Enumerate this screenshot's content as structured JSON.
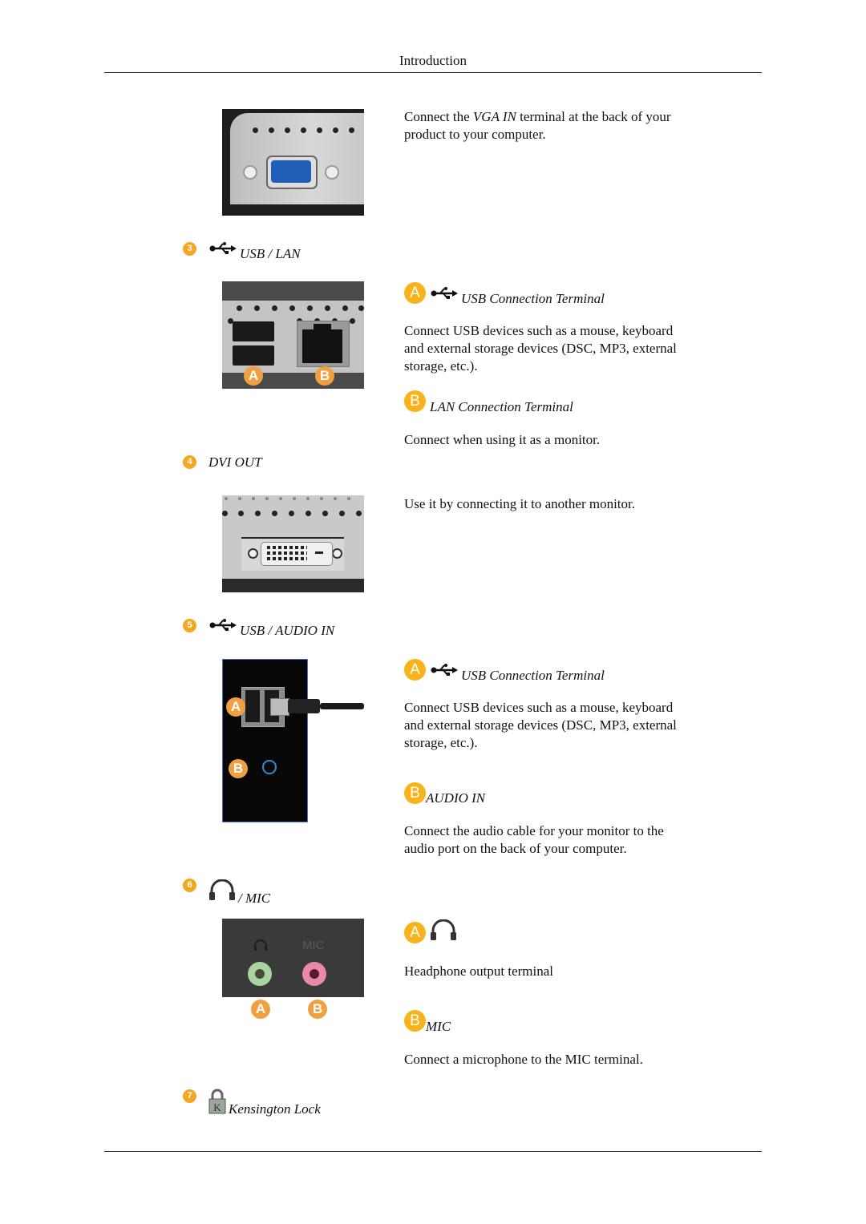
{
  "page": {
    "header": "Introduction"
  },
  "vga": {
    "text_before": "Connect the ",
    "text_emph": "VGA IN",
    "text_after": " terminal at the back of your product to your computer."
  },
  "sections": [
    {
      "number": "3",
      "icon": "usb-icon",
      "title": "USB / LAN",
      "image_labels": [
        "A",
        "B"
      ],
      "items": [
        {
          "badge": "A",
          "icon": "usb-icon",
          "title": "USB Connection Terminal",
          "description": "Connect USB devices such as a mouse, keyboard and external storage devices (DSC, MP3, external storage, etc.)."
        },
        {
          "badge": "B",
          "title": "LAN Connection Terminal",
          "description": "Connect when using it as a monitor."
        }
      ]
    },
    {
      "number": "4",
      "title": "DVI OUT",
      "description": "Use it by connecting it to another monitor."
    },
    {
      "number": "5",
      "icon": "usb-icon",
      "title": "USB / AUDIO IN",
      "image_labels": [
        "A",
        "B"
      ],
      "items": [
        {
          "badge": "A",
          "icon": "usb-icon",
          "title": "USB Connection Terminal",
          "description": "Connect USB devices such as a mouse, keyboard and external storage devices (DSC, MP3, external storage, etc.)."
        },
        {
          "badge": "B",
          "title": "AUDIO IN",
          "description": "Connect the audio cable for your monitor to the audio port on the back of your computer."
        }
      ]
    },
    {
      "number": "6",
      "icon": "headphone-icon",
      "title": "/ MIC",
      "image_labels": [
        "A",
        "B"
      ],
      "panel_mic_label": "MIC",
      "items": [
        {
          "badge": "A",
          "icon": "headphone-icon",
          "title": "",
          "description": "Headphone output terminal"
        },
        {
          "badge": "B",
          "title": "MIC",
          "description": "Connect a microphone to the MIC terminal."
        }
      ]
    },
    {
      "number": "7",
      "icon": "kensington-lock-icon",
      "title": "Kensington Lock"
    }
  ],
  "colors": {
    "badge_orange": "#f5a623",
    "vga_blue": "#1f5fb8",
    "headphone_jack_green": "#a8d5a0",
    "mic_jack_pink": "#e68aa8",
    "audio_in_ring_blue": "#2a8fd0"
  }
}
